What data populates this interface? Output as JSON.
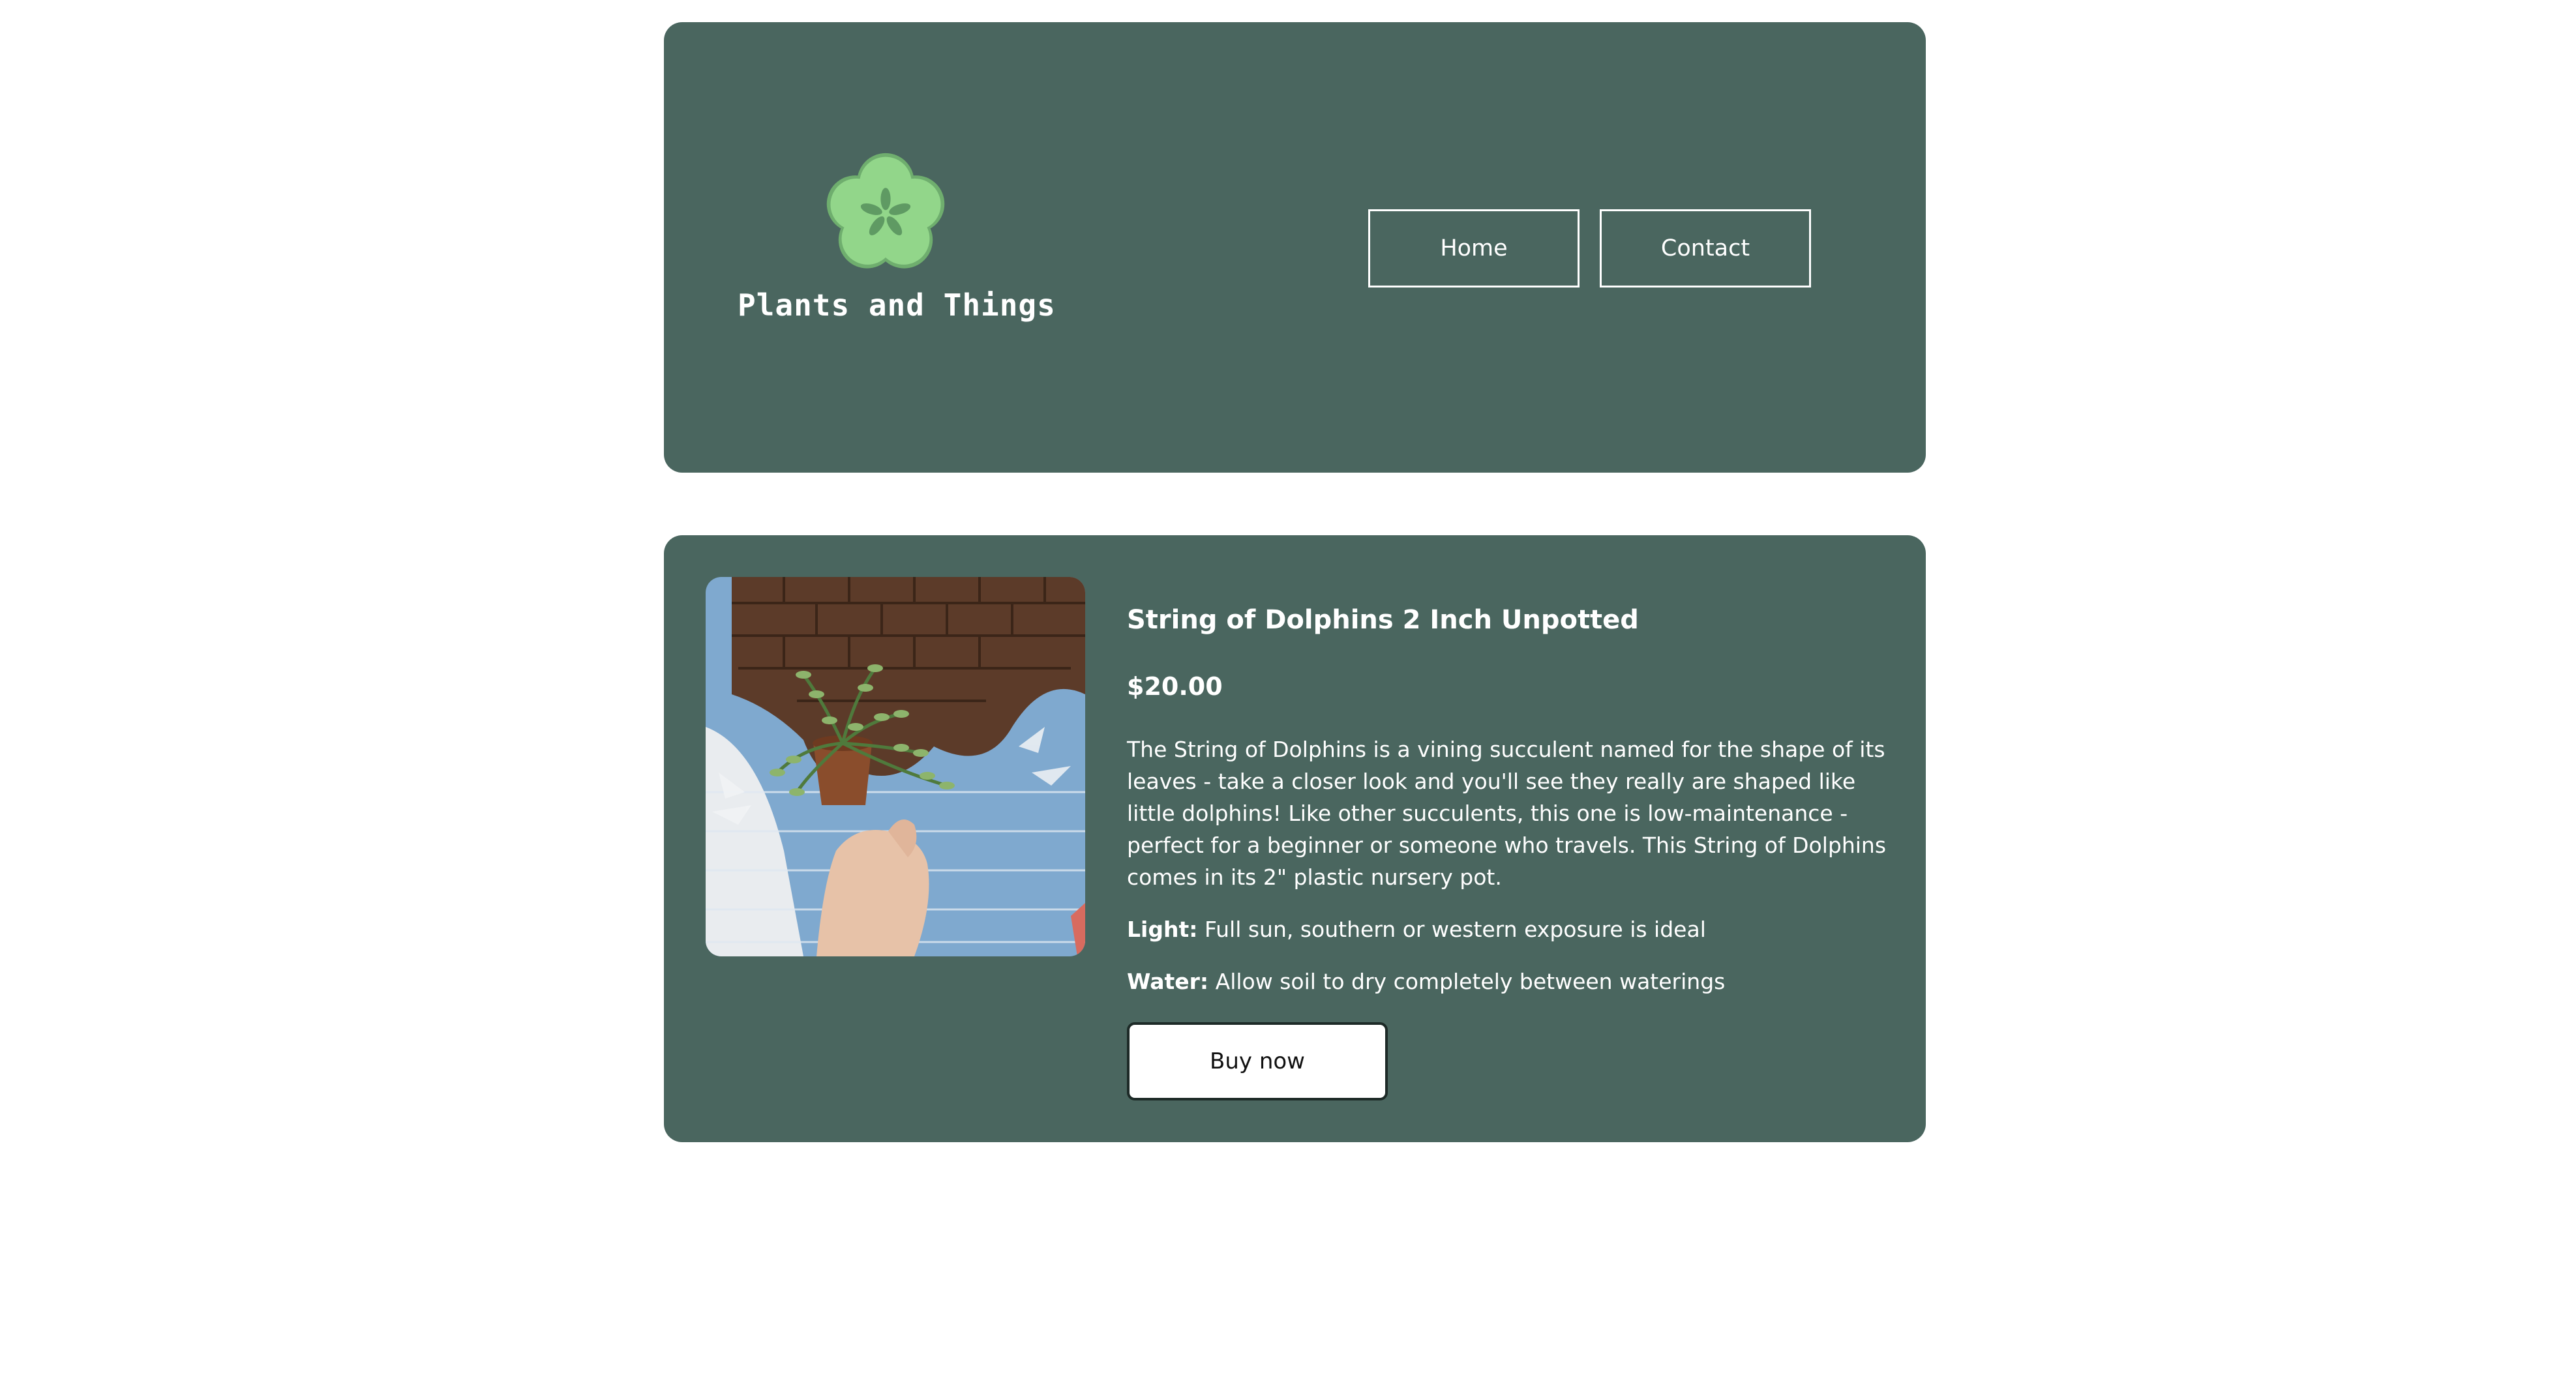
{
  "header": {
    "brand": "Plants and Things",
    "logo_icon": "flower-logo-icon",
    "nav": [
      {
        "label": "Home"
      },
      {
        "label": "Contact"
      }
    ]
  },
  "product": {
    "title": "String of Dolphins 2 Inch Unpotted",
    "price": "$20.00",
    "description": "The String of Dolphins is a vining succulent named for the shape of its leaves - take a closer look and you'll see they really are shaped like little dolphins! Like other succulents, this one is low-maintenance - perfect for a beginner or someone who travels. This String of Dolphins comes in its 2\" plastic nursery pot.",
    "light_label": "Light:",
    "light_value": "Full sun, southern or western exposure is ideal",
    "water_label": "Water:",
    "water_value": "Allow soil to dry completely between waterings",
    "buy_label": "Buy now",
    "image_alt": "hand holding potted succulent in front of painted brick wall"
  },
  "colors": {
    "card_bg": "#4a665f",
    "logo_green_light": "#92d68a",
    "logo_green_dark": "#5f9a63",
    "text": "#ffffff"
  }
}
